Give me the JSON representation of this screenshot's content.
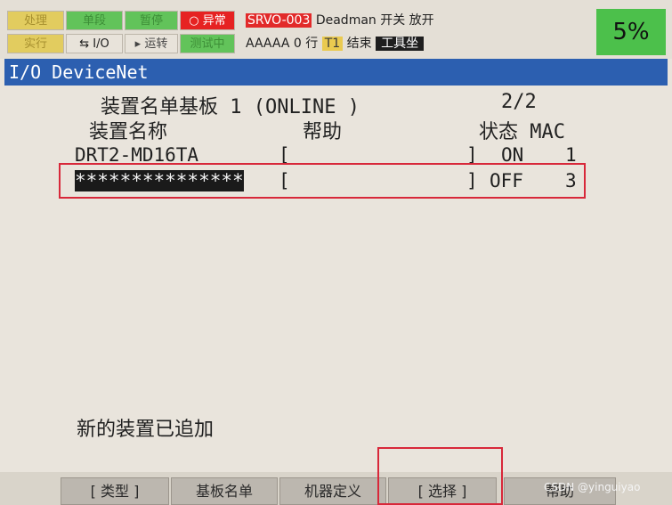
{
  "status_leds": {
    "row1": [
      "处理",
      "单段",
      "暂停",
      "异常"
    ],
    "row2": [
      "实行",
      "I/O",
      "运转",
      "测试中"
    ]
  },
  "status_line": {
    "alarm_code": "SRVO-003",
    "alarm_text": "Deadman",
    "alarm_detail": "开关 放开",
    "program": "AAAAA",
    "line_number": "0",
    "line_label": "行",
    "mode": "T1",
    "state": "结束",
    "frame": "工具坐"
  },
  "speed_override": "5%",
  "screen": {
    "title": "I/O DeviceNet",
    "header": {
      "board_label": "装置名单基板 1 (ONLINE )",
      "page": "2/2",
      "col_name": "装置名称",
      "col_help": "帮助",
      "col_status_mac": "状态 MAC"
    },
    "devices": [
      {
        "name": "DRT2-MD16TA",
        "bracket_open": "[",
        "bracket_close": "]",
        "status": "ON",
        "mac": "1"
      },
      {
        "name": "***************",
        "bracket_open": "[",
        "bracket_close": "]",
        "status": "OFF",
        "mac": "3"
      }
    ],
    "message": "新的装置已追加"
  },
  "function_keys": [
    "[ 类型 ]",
    "基板名单",
    "机器定义",
    "[ 选择 ]",
    "帮助"
  ],
  "watermark": "CSDN @yinguiyao"
}
